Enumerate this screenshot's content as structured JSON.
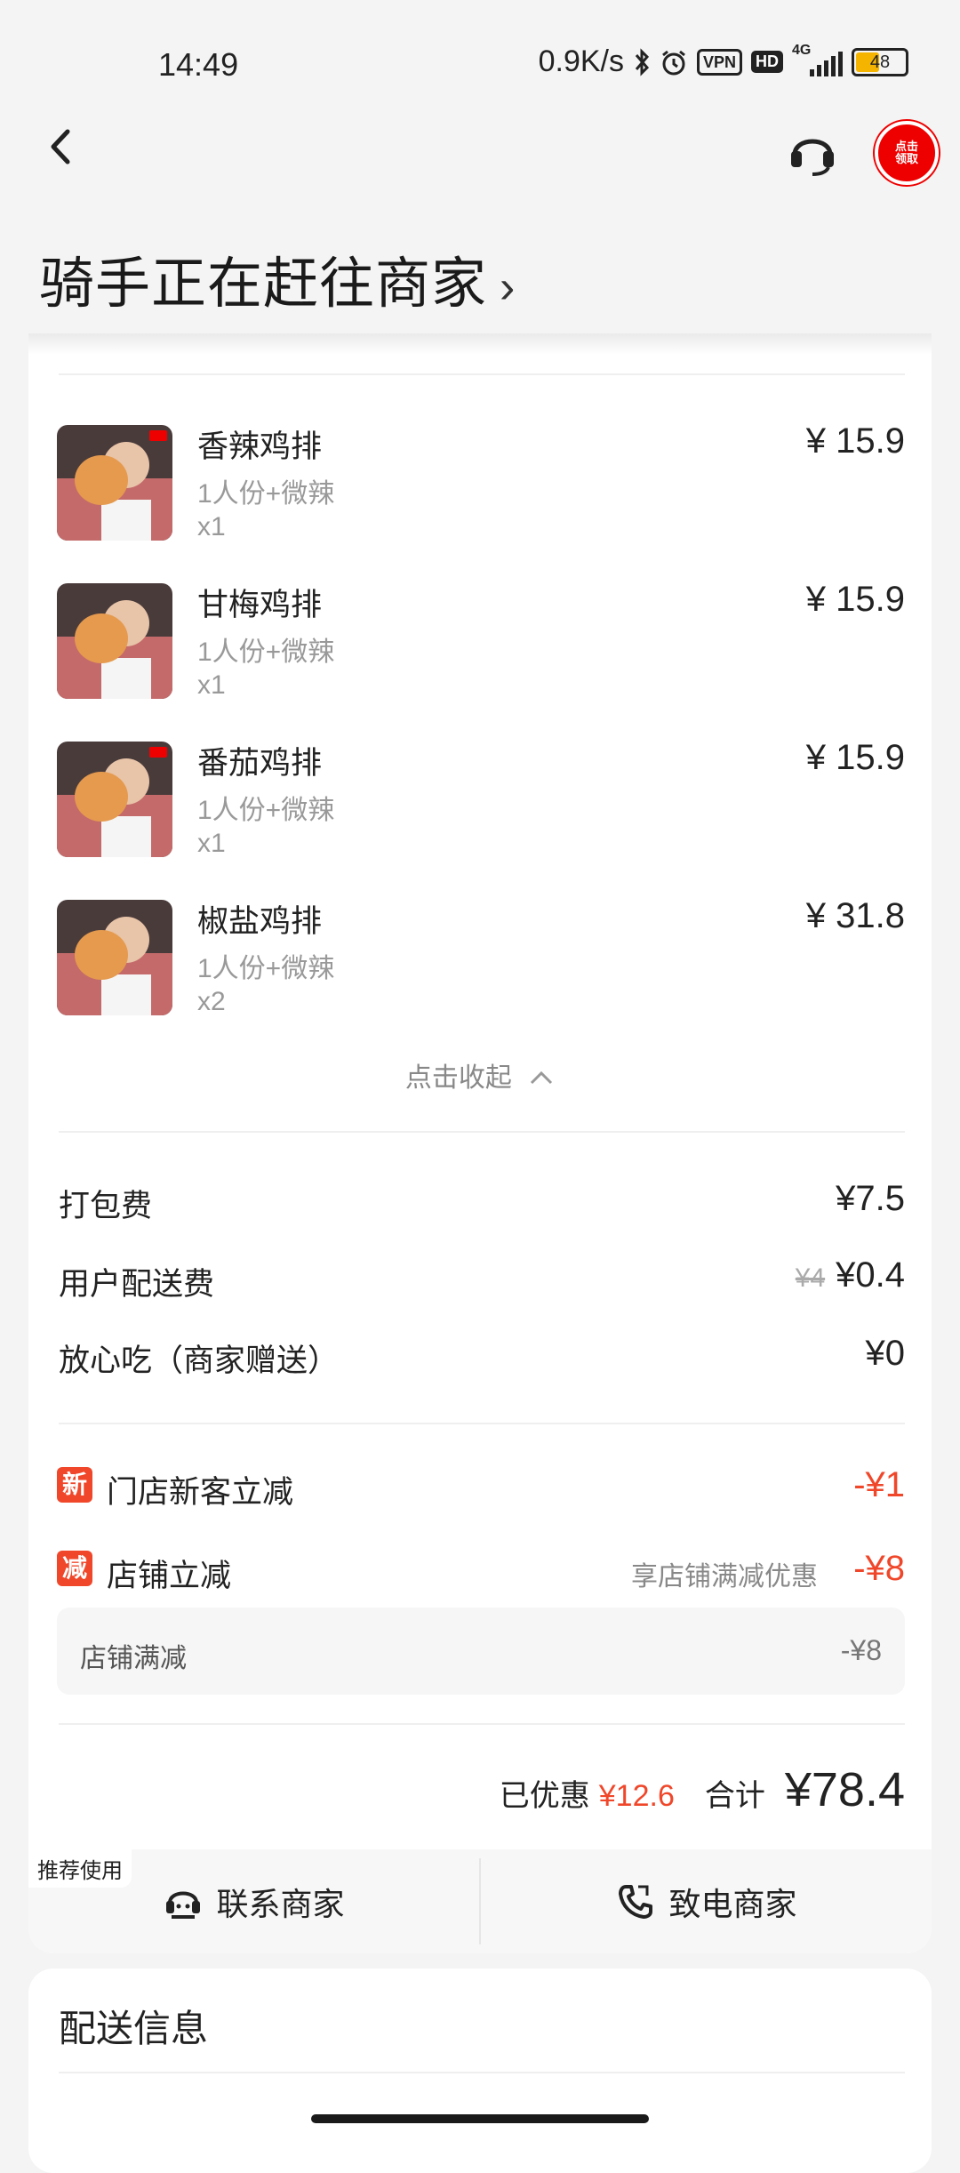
{
  "status_bar": {
    "time": "14:49",
    "speed": "0.9K/s",
    "vpn": "VPN",
    "hd": "HD",
    "net": "4G",
    "battery": "48"
  },
  "nav": {
    "coupon_text": "点击领取"
  },
  "header": {
    "title": "骑手正在赶往商家",
    "chevron": "›"
  },
  "items": [
    {
      "name": "香辣鸡排",
      "spec": "1人份+微辣",
      "qty": "x1",
      "price": "¥ 15.9"
    },
    {
      "name": "甘梅鸡排",
      "spec": "1人份+微辣",
      "qty": "x1",
      "price": "¥ 15.9"
    },
    {
      "name": "番茄鸡排",
      "spec": "1人份+微辣",
      "qty": "x1",
      "price": "¥ 15.9"
    },
    {
      "name": "椒盐鸡排",
      "spec": "1人份+微辣",
      "qty": "x2",
      "price": "¥ 31.8"
    }
  ],
  "collapse": {
    "label": "点击收起",
    "icon": "chevron-up-icon"
  },
  "fees": {
    "packing_label": "打包费",
    "packing_value": "¥7.5",
    "delivery_label": "用户配送费",
    "delivery_original": "¥4",
    "delivery_value": "¥0.4",
    "safe_label": "放心吃（商家赠送）",
    "safe_value": "¥0"
  },
  "promos": {
    "new_badge": "新",
    "new_label": "门店新客立减",
    "new_value": "-¥1",
    "shop_badge": "减",
    "shop_label": "店铺立减",
    "shop_hint": "享店铺满减优惠",
    "shop_value": "-¥8",
    "sub_label": "店铺满减",
    "sub_value": "-¥8"
  },
  "total": {
    "saved_label": "已优惠",
    "saved_value": "¥12.6",
    "total_label": "合计",
    "total_value": "¥78.4"
  },
  "actions": {
    "recommend_tag": "推荐使用",
    "contact": "联系商家",
    "call": "致电商家"
  },
  "delivery_info": {
    "title": "配送信息"
  },
  "colors": {
    "accent": "#f0472a",
    "coupon": "#e00000"
  }
}
